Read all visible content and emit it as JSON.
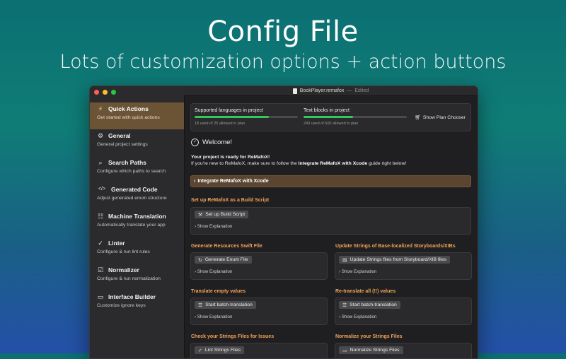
{
  "hero": {
    "title": "Config File",
    "subtitle": "Lots of customization options + action buttons"
  },
  "window": {
    "filename": "BookPlayer.remafox",
    "separator": "—",
    "status": "Edited"
  },
  "sidebar": {
    "items": [
      {
        "title": "Quick Actions",
        "desc": "Get started with quick actions",
        "icon": "bolt-icon",
        "glyph": "⚡"
      },
      {
        "title": "General",
        "desc": "General project settings",
        "icon": "gear-icon",
        "glyph": "⚙"
      },
      {
        "title": "Search Paths",
        "desc": "Configure which paths to search",
        "icon": "search-icon",
        "glyph": "⌕"
      },
      {
        "title": "Generated Code",
        "desc": "Adjust generated enum structure",
        "icon": "code-icon",
        "glyph": "</>"
      },
      {
        "title": "Machine Translation",
        "desc": "Automatically translate your app",
        "icon": "translate-icon",
        "glyph": "☷"
      },
      {
        "title": "Linter",
        "desc": "Configure & run lint rules",
        "icon": "check-circle-icon",
        "glyph": "✓"
      },
      {
        "title": "Normalizer",
        "desc": "Configure & run normalization",
        "icon": "check-square-icon",
        "glyph": "☑"
      },
      {
        "title": "Interface Builder",
        "desc": "Customize ignore keys",
        "icon": "rectangle-icon",
        "glyph": "▭"
      }
    ]
  },
  "plan": {
    "languages_label": "Supported languages in project",
    "languages_used": "18 used of 25 allowed in plan",
    "languages_fraction": 0.72,
    "blocks_label": "Text blocks in project",
    "blocks_used": "240 used of 500 allowed in plan",
    "blocks_fraction": 0.48,
    "button": "Show Plan Chooser"
  },
  "welcome": {
    "title": "Welcome!",
    "ready": "Your project is ready for ReMafoX!",
    "desc_prefix": "If you're new to ReMafoX, make sure to follow the ",
    "desc_link": "Integrate ReMafoX with Xcode",
    "desc_suffix": " guide right below!"
  },
  "integrate": "Integrate ReMafoX with Xcode",
  "explanation_label": "Show Explanation",
  "sections": {
    "build": {
      "title": "Set up ReMafoX as a Build Script",
      "button": "Set up Build Script"
    },
    "swift": {
      "title": "Generate Resources Swift File",
      "button": "Generate Enum File"
    },
    "storyboards": {
      "title": "Update Strings of Base-localized Storyboards/XIBs",
      "button": "Update Strings files from Storyboard/XIB files"
    },
    "translate": {
      "title": "Translate empty values",
      "button": "Start batch-translation"
    },
    "retranslate": {
      "title": "Re-translate all (!!) values",
      "button": "Start batch-translation"
    },
    "check": {
      "title": "Check your Strings Files for Issues",
      "button": "Lint Strings Files"
    },
    "normalize": {
      "title": "Normalize your Strings Files",
      "button": "Normalize Strings Files"
    }
  }
}
